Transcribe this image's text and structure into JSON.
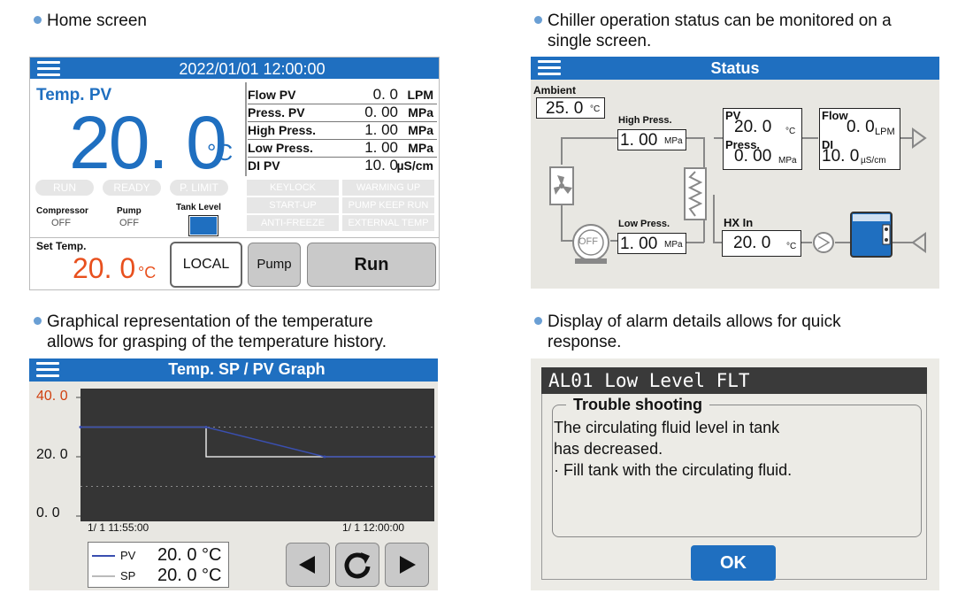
{
  "captions": {
    "home": [
      "Home screen"
    ],
    "status": [
      "Chiller operation status can be monitored on a",
      "single screen."
    ],
    "graph": [
      "Graphical representation of the temperature",
      "allows for grasping of the temperature history."
    ],
    "alarm": [
      "Display of alarm details allows for quick",
      "response."
    ]
  },
  "home": {
    "datetime": "2022/01/01   12:00:00",
    "temp_label": "Temp. PV",
    "temp_value": "20. 0",
    "temp_unit": "°C",
    "measurements": [
      {
        "name": "Flow PV",
        "value": "0. 0",
        "unit": "LPM"
      },
      {
        "name": "Press. PV",
        "value": "0. 00",
        "unit": "MPa"
      },
      {
        "name": "High Press.",
        "value": "1. 00",
        "unit": "MPa"
      },
      {
        "name": "Low Press.",
        "value": "1. 00",
        "unit": "MPa"
      },
      {
        "name": "DI PV",
        "value": "10. 0",
        "unit": "µS/cm"
      }
    ],
    "status_pills": [
      "RUN",
      "READY",
      "P. LIMIT"
    ],
    "indicators": [
      "KEYLOCK",
      "WARMING UP",
      "START-UP",
      "PUMP KEEP RUN",
      "ANTI-FREEZE",
      "EXTERNAL TEMP"
    ],
    "compressor_label": "Compressor",
    "compressor_value": "OFF",
    "pump_label": "Pump",
    "pump_value": "OFF",
    "tank_label": "Tank Level",
    "set_temp_label": "Set Temp.",
    "set_temp_value": "20. 0",
    "set_temp_unit": "°C",
    "local_label": "LOCAL",
    "pump_button": "Pump",
    "run_button": "Run"
  },
  "status": {
    "title": "Status",
    "ambient_label": "Ambient",
    "ambient_value": "25. 0",
    "ambient_unit": "°C",
    "high_press_label": "High Press.",
    "high_press_value": "1. 00",
    "high_press_unit": "MPa",
    "low_press_label": "Low Press.",
    "low_press_value": "1. 00",
    "low_press_unit": "MPa",
    "pv_label": "PV",
    "pv_value": "20. 0",
    "pv_unit": "°C",
    "press_label": "Press.",
    "press_value": "0. 00",
    "press_unit": "MPa",
    "flow_label": "Flow",
    "flow_value": "0. 0",
    "flow_unit": "LPM",
    "di_label": "DI",
    "di_value": "10. 0",
    "di_unit": "µS/cm",
    "hx_label": "HX In",
    "hx_value": "20. 0",
    "hx_unit": "°C",
    "compressor_state": "OFF"
  },
  "graph": {
    "title": "Temp. SP / PV Graph",
    "legend": [
      {
        "name": "PV",
        "value": "20. 0",
        "unit": "°C"
      },
      {
        "name": "SP",
        "value": "20. 0",
        "unit": "°C"
      }
    ]
  },
  "chart_data": {
    "type": "line",
    "title": "Temp. SP / PV Graph",
    "xlabel": "",
    "ylabel": "",
    "x_tick_labels": [
      "1/ 1   11:55:00",
      "1/ 1   12:00:00"
    ],
    "y_tick_labels": [
      "40. 0",
      "20. 0",
      "0. 0"
    ],
    "ylim": [
      0,
      40
    ],
    "x": [
      0,
      0.355,
      0.69,
      1
    ],
    "series": [
      {
        "name": "PV",
        "values": [
          30,
          30,
          20,
          20
        ]
      },
      {
        "name": "SP",
        "values": [
          30,
          30,
          20,
          20
        ]
      }
    ],
    "grid": true,
    "colors": {
      "PV": "#3a4fb0",
      "SP": "#ffffff",
      "ytop_label": "#d04010"
    }
  },
  "alarm": {
    "code_title": "AL01 Low Level FLT",
    "section_title": "Trouble shooting",
    "message_lines": [
      "The circulating fluid level in tank",
      "has decreased.",
      "· Fill tank with the circulating fluid."
    ],
    "ok_label": "OK"
  }
}
